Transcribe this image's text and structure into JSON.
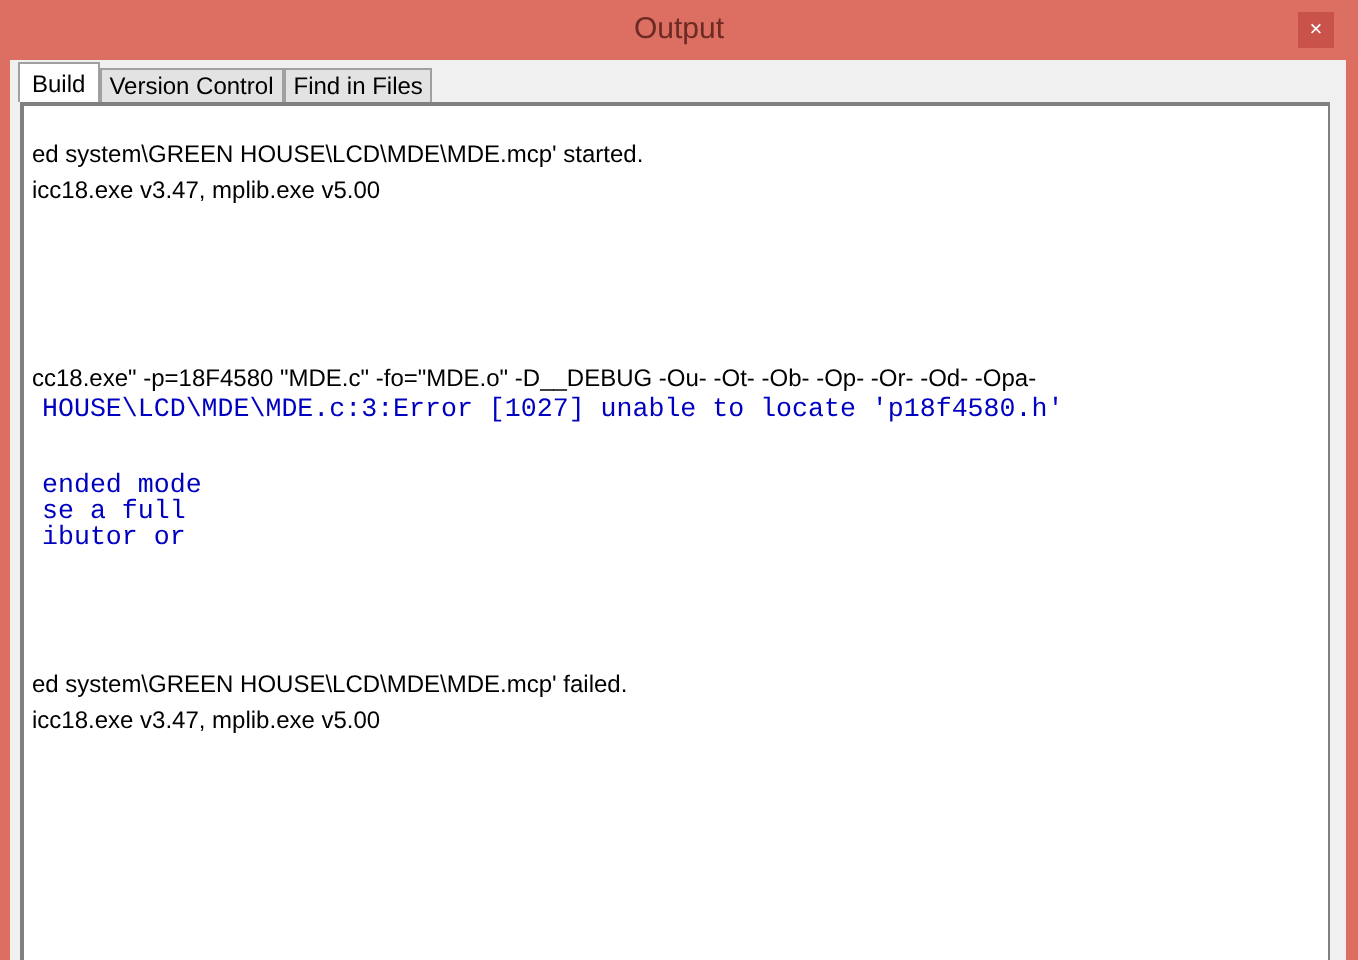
{
  "window": {
    "title": "Output",
    "close": "×"
  },
  "tabs": [
    {
      "label": "Build",
      "selected": true
    },
    {
      "label": "Version Control",
      "selected": false
    },
    {
      "label": "Find in Files",
      "selected": false
    }
  ],
  "output_blocks": [
    [
      {
        "kind": "message",
        "text": "ed system\\GREEN HOUSE\\LCD\\MDE\\MDE.mcp' started."
      },
      {
        "kind": "message",
        "text": "icc18.exe v3.47, mplib.exe v5.00"
      }
    ],
    [
      {
        "kind": "message",
        "text": "cc18.exe\" -p=18F4580 \"MDE.c\" -fo=\"MDE.o\" -D__DEBUG -Ou- -Ot- -Ob- -Op- -Or- -Od- -Opa-"
      },
      {
        "kind": "compiler",
        "text": "HOUSE\\LCD\\MDE\\MDE.c:3:Error [1027] unable to locate 'p18f4580.h'"
      }
    ],
    [
      {
        "kind": "compiler",
        "text": "ended mode"
      },
      {
        "kind": "compiler",
        "text": "se a full"
      },
      {
        "kind": "compiler",
        "text": "ibutor or"
      }
    ],
    [
      {
        "kind": "message",
        "text": "ed system\\GREEN HOUSE\\LCD\\MDE\\MDE.mcp' failed."
      },
      {
        "kind": "message",
        "text": "icc18.exe v3.47, mplib.exe v5.00"
      }
    ]
  ]
}
